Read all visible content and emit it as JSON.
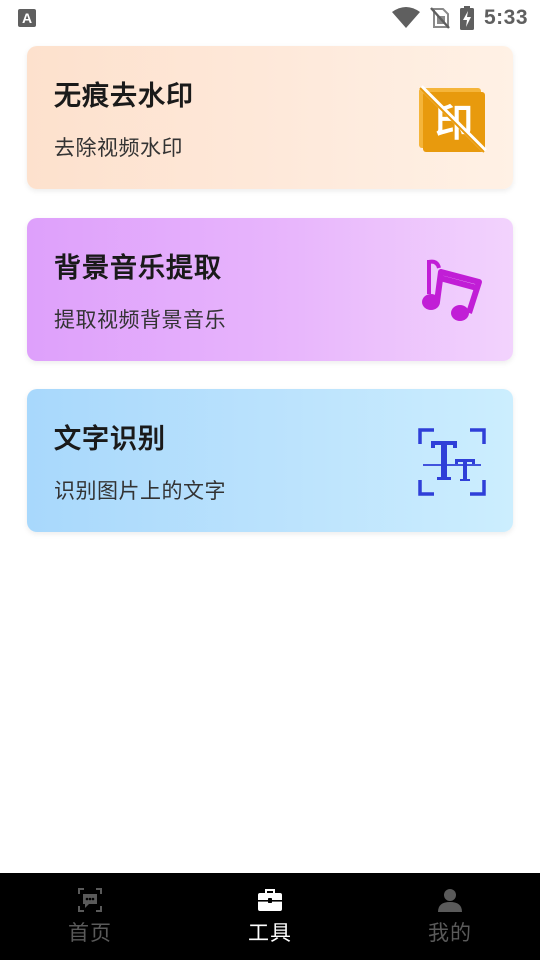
{
  "status_bar": {
    "time": "5:33",
    "icons": [
      "keyboard-a-icon",
      "wifi-icon",
      "no-sim-icon",
      "battery-charging-icon"
    ]
  },
  "tools": [
    {
      "title": "无痕去水印",
      "subtitle": "去除视频水印",
      "icon": "no-watermark-icon",
      "icon_text": "印"
    },
    {
      "title": "背景音乐提取",
      "subtitle": "提取视频背景音乐",
      "icon": "music-note-icon"
    },
    {
      "title": "文字识别",
      "subtitle": "识别图片上的文字",
      "icon": "text-scan-icon"
    }
  ],
  "bottom_nav": {
    "items": [
      {
        "label": "首页",
        "icon": "chat-icon",
        "active": false
      },
      {
        "label": "工具",
        "icon": "toolbox-icon",
        "active": true
      },
      {
        "label": "我的",
        "icon": "person-icon",
        "active": false
      }
    ]
  },
  "colors": {
    "card1_gradient": [
      "#fde1cd",
      "#fff1e5"
    ],
    "card2_gradient": [
      "#dea0fb",
      "#f2d3fd"
    ],
    "card3_gradient": [
      "#a8d8fc",
      "#cceefe"
    ],
    "nav_background": "#000000",
    "nav_active": "#ffffff",
    "nav_inactive": "#5a5a5a"
  }
}
